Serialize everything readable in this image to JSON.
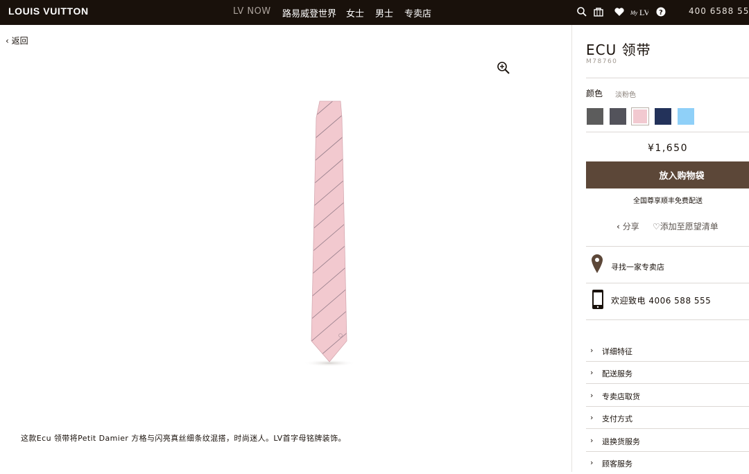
{
  "header": {
    "logo": "LOUIS VUITTON",
    "nav": [
      {
        "label": "LV NOW"
      },
      {
        "label": "路易威登世界"
      },
      {
        "label": "女士"
      },
      {
        "label": "男士"
      },
      {
        "label": "专卖店"
      }
    ],
    "phone": "400 6588 55"
  },
  "main": {
    "back_label": "返回",
    "description": "这款Ecu 领带将Petit Damier 方格与闪亮真丝细条纹混搭，时尚迷人。LV首字母铭牌装饰。"
  },
  "product": {
    "title": "ECU 领带",
    "sku": "M78760",
    "color_label": "颜色",
    "color_value": "淡粉色",
    "swatches": [
      {
        "color": "#5c5c5c"
      },
      {
        "color": "#53535b"
      },
      {
        "color": "#f2c9d0"
      },
      {
        "color": "#23325a"
      },
      {
        "color": "#8fd0f8"
      }
    ],
    "price": "¥1,650",
    "add_to_bag": "放入购物袋",
    "shipping_note": "全国尊享顺丰免费配送",
    "share": "分享",
    "wishlist": "添加至愿望清单",
    "find_store": "寻找一家专卖店",
    "call_us": "欢迎致电 4006 588 555",
    "accordion": [
      {
        "label": "详细特征"
      },
      {
        "label": "配送服务"
      },
      {
        "label": "专卖店取货"
      },
      {
        "label": "支付方式"
      },
      {
        "label": "退换货服务"
      },
      {
        "label": "顾客服务"
      }
    ]
  },
  "colors": {
    "header_bg": "#19110b",
    "button_bg": "#5c4738",
    "tie_pink": "#f2c9cf"
  }
}
